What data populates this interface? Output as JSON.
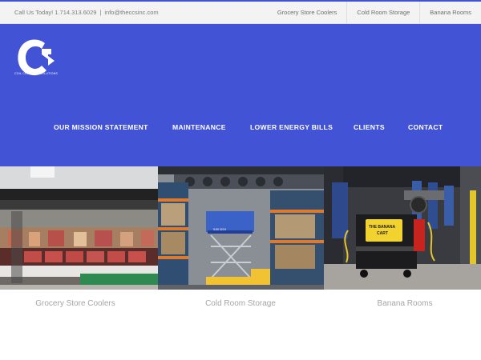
{
  "topbar": {
    "call_text": "Call Us Today! 1.714.313.6029",
    "separator": "|",
    "email": "info@theccsinc.com",
    "links": [
      "Grocery Store Coolers",
      "Cold Room Storage",
      "Banana Rooms"
    ]
  },
  "brand": {
    "logo_letter": "C",
    "tagline": "COIL CLEANING SOLUTIONS"
  },
  "nav": {
    "items": [
      "OUR MISSION STATEMENT",
      "MAINTENANCE",
      "LOWER ENERGY BILLS",
      "CLIENTS",
      "CONTACT"
    ]
  },
  "gallery": {
    "captions": [
      "Grocery Store Coolers",
      "Cold Room Storage",
      "Banana Rooms"
    ],
    "banana_cart_sign": [
      "THE BANANA",
      "CART"
    ],
    "lift_label": "SJIII 3219"
  },
  "colors": {
    "header_bg": "#4253d5",
    "topbar_bg": "#f3f3f3",
    "caption_text": "#a5a5a5"
  }
}
